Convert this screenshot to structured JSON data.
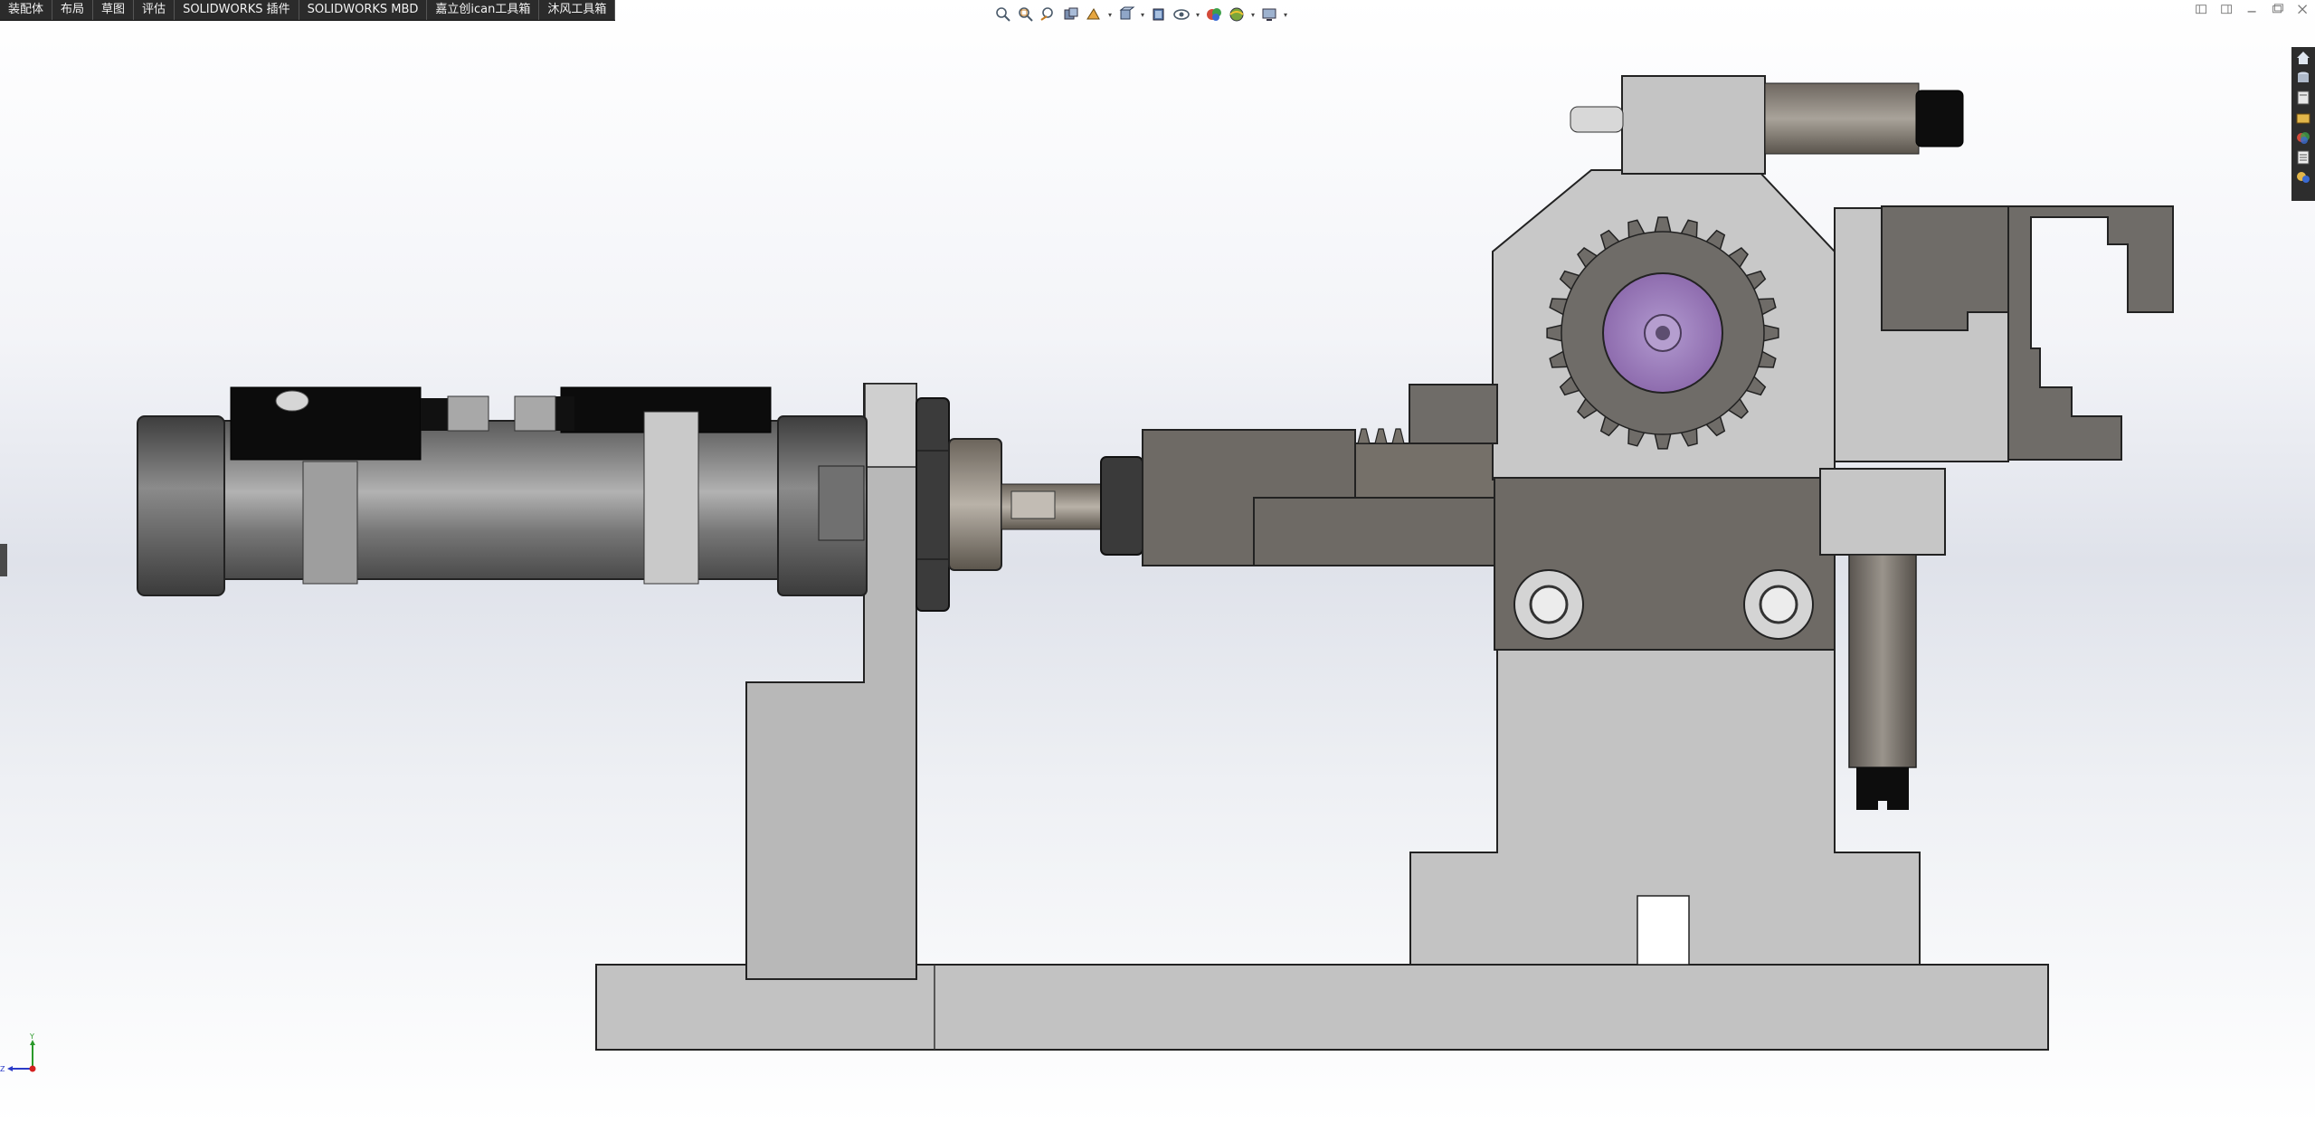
{
  "tabs": [
    {
      "label": "装配体"
    },
    {
      "label": "布局"
    },
    {
      "label": "草图"
    },
    {
      "label": "评估"
    },
    {
      "label": "SOLIDWORKS 插件"
    },
    {
      "label": "SOLIDWORKS MBD"
    },
    {
      "label": "嘉立创ican工具箱"
    },
    {
      "label": "沐风工具箱"
    }
  ],
  "heads_up_toolbar": [
    {
      "icon": "zoom-to-fit-icon"
    },
    {
      "icon": "zoom-to-area-icon"
    },
    {
      "icon": "previous-view-icon"
    },
    {
      "icon": "section-view-icon"
    },
    {
      "icon": "dynamic-annotation-icon"
    },
    {
      "icon": "view-orientation-icon"
    },
    {
      "icon": "display-style-icon"
    },
    {
      "icon": "hide-show-items-icon"
    },
    {
      "icon": "edit-appearance-icon"
    },
    {
      "icon": "apply-scene-icon"
    },
    {
      "icon": "view-settings-icon"
    }
  ],
  "window_controls": [
    "restore-left-icon",
    "restore-right-icon",
    "minimize-icon",
    "maximize-icon",
    "close-icon"
  ],
  "task_pane": [
    "home-icon",
    "resources-icon",
    "design-library-icon",
    "file-explorer-icon",
    "appearances-icon",
    "custom-properties-icon",
    "forum-icon"
  ],
  "triad": {
    "axis_y": "Y",
    "axis_z": "Z"
  },
  "colors": {
    "steel_light": "#b4b4b4",
    "steel_dark": "#6f6c68",
    "cylinder_black": "#0c0c0c",
    "hub_purple": "#9b7fb7",
    "base_plate": "#c3c3c3"
  }
}
